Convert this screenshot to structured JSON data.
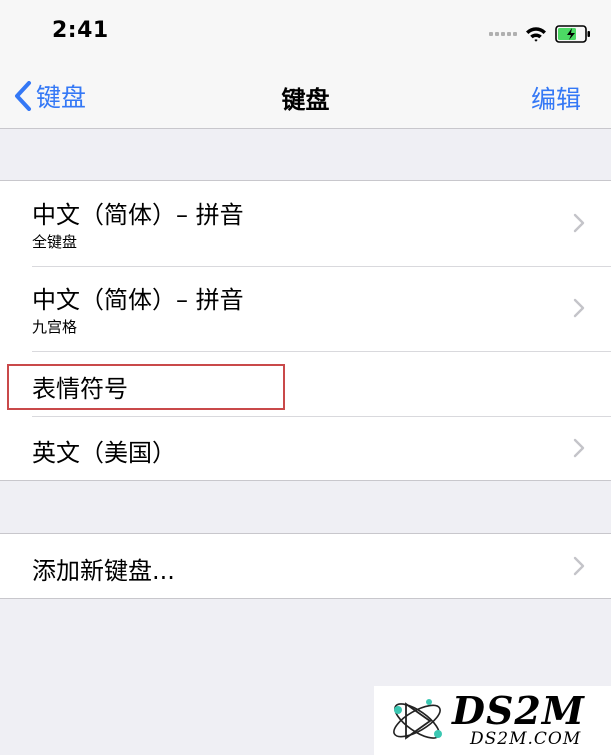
{
  "status_bar": {
    "time": "2:41"
  },
  "nav": {
    "back_label": "键盘",
    "title": "键盘",
    "edit_label": "编辑"
  },
  "keyboards": [
    {
      "title": "中文（简体）– 拼音",
      "subtitle": "全键盘"
    },
    {
      "title": "中文（简体）– 拼音",
      "subtitle": "九宫格"
    },
    {
      "title": "表情符号"
    },
    {
      "title": "英文（美国）"
    }
  ],
  "add_keyboard": {
    "label": "添加新键盘..."
  },
  "watermark": {
    "logo_text": "DS2M",
    "site": "DS2M.COM"
  },
  "colors": {
    "accent": "#3478f6",
    "highlight_border": "#c9494a",
    "battery_fill": "#4cd964",
    "background": "#efeff4"
  }
}
